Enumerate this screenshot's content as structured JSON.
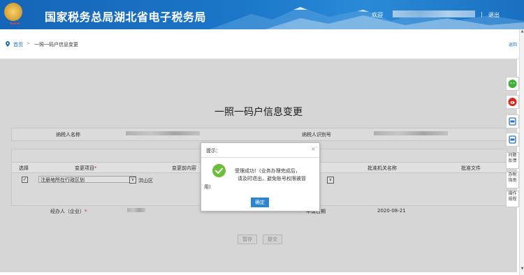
{
  "header": {
    "site_title": "国家税务总局湖北省电子税务局",
    "welcome": "欢迎",
    "separator": "|",
    "logout": "退出"
  },
  "breadcrumb": {
    "home": "首页",
    "separator": ">",
    "current": "一照一码户信息变更",
    "back": "返回"
  },
  "form": {
    "title": "一照一码户信息变更",
    "taxpayer_name_label": "纳税人名称",
    "taxpayer_id_label": "纳税人识别号",
    "table_headers": {
      "select": "选择",
      "change_item": "变更项目",
      "before_change": "变更前内容",
      "approver": "批准机关名称",
      "approval_doc": "批准文件"
    },
    "required_mark": "*",
    "row": {
      "checked_mark": "✓",
      "change_item_value": "注册地所在行政区划",
      "before_value": "洪山区"
    },
    "handler_label": "经办人（企业）",
    "apply_date_label": "申请日期",
    "apply_date_value": "2020-08-21",
    "save_button": "暂存",
    "submit_button": "提交",
    "dropdown_arrow": "∨"
  },
  "dialog": {
    "title": "提示：",
    "close": "×",
    "message_line1": "受理成功！(业务办理完成后，",
    "message_line2": "请及时退出，避免账号权限被冒",
    "message_line3": "用)",
    "ok_button": "确定"
  },
  "right_tools": {
    "feedback": "问题反馈",
    "guide": "办税指南",
    "manual": "操作规程"
  },
  "colors": {
    "header_blue": "#1b76c9",
    "primary_button": "#2a86d1",
    "success_green": "#6cbf3b",
    "required_red": "#d9262c"
  }
}
